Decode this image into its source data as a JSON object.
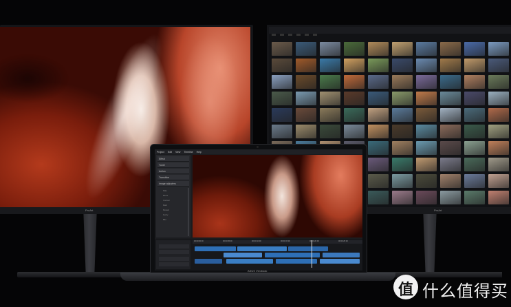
{
  "left_monitor": {
    "brand": "ProArt"
  },
  "right_monitor": {
    "brand": "ProArt",
    "thumb_colors": [
      "#6a5a4a",
      "#3a5a78",
      "#7a8aa0",
      "#4a6a3a",
      "#b08a5a",
      "#c0a070",
      "#5a7aa0",
      "#8a6a4a",
      "#4a6aa8",
      "#7a9ac0",
      "#5a4a3a",
      "#a05a2a",
      "#3a7aa8",
      "#d0a060",
      "#7a9a5a",
      "#3a4a6a",
      "#6a8ab0",
      "#a07a4a",
      "#c09a6a",
      "#4a5a7a",
      "#8aa0c0",
      "#6a4a2a",
      "#4a7a4a",
      "#c06a3a",
      "#5a6a8a",
      "#9a7a5a",
      "#7a6a9a",
      "#3a6a8a",
      "#b08060",
      "#6a7a5a",
      "#4a5a4a",
      "#7a9ab0",
      "#a09070",
      "#5a3a2a",
      "#3a5a7a",
      "#8a9a6a",
      "#c07a4a",
      "#6a8a9a",
      "#4a4a6a",
      "#9ab0c0",
      "#2a3a5a",
      "#6a4a3a",
      "#8a7a5a",
      "#3a6a5a",
      "#c0a080",
      "#5a7a9a",
      "#7a5a3a",
      "#a0b0c0",
      "#4a6a7a",
      "#b06a4a",
      "#6a7a8a",
      "#9a8a6a",
      "#3a4a3a",
      "#7a8a9a",
      "#c09060",
      "#4a3a2a",
      "#5a8aa0",
      "#8a6a5a",
      "#3a5a4a",
      "#a0a080",
      "#7a6a5a",
      "#4a7a9a",
      "#b09070",
      "#5a5a6a",
      "#3a6a7a",
      "#a08060",
      "#6a9ab0",
      "#5a4a4a",
      "#8aa090",
      "#c0805a",
      "#5a6a5a",
      "#9a7a6a",
      "#4a5a8a",
      "#b0a080",
      "#6a5a7a",
      "#3a7a6a",
      "#c09a70",
      "#7a7a8a",
      "#4a6a5a",
      "#a09a8a",
      "#3a4a5a",
      "#8a6a4a",
      "#6a8a7a",
      "#b07a5a",
      "#5a5a4a",
      "#7a9aa0",
      "#4a4a3a",
      "#a0806a",
      "#6a7a9a",
      "#c0a090",
      "#5a3a3a",
      "#7a8a6a",
      "#4a6a8a",
      "#b0907a",
      "#3a5a5a",
      "#9a7a8a",
      "#6a4a5a",
      "#8a9aa0",
      "#5a7a6a",
      "#c08070"
    ]
  },
  "laptop": {
    "brand": "ASUS Vivobook",
    "menu": [
      "Project",
      "Edit",
      "View",
      "Timeline",
      "Help"
    ],
    "panel_buttons": [
      "Effect",
      "Tuner",
      "Action",
      "Transition",
      "Image adjusters"
    ],
    "panel_items": [
      "Pale",
      "Mirror",
      "Contour",
      "Dark",
      "Mosaic",
      "Fuzzy",
      "Blur"
    ],
    "timeline_markers": [
      "00:00:00:00",
      "00:00:05:00",
      "00:00:10:00",
      "00:00:15:00",
      "00:00:20:00",
      "00:00:25:00"
    ]
  },
  "watermark": {
    "glyph": "值",
    "text": "什么值得买"
  }
}
